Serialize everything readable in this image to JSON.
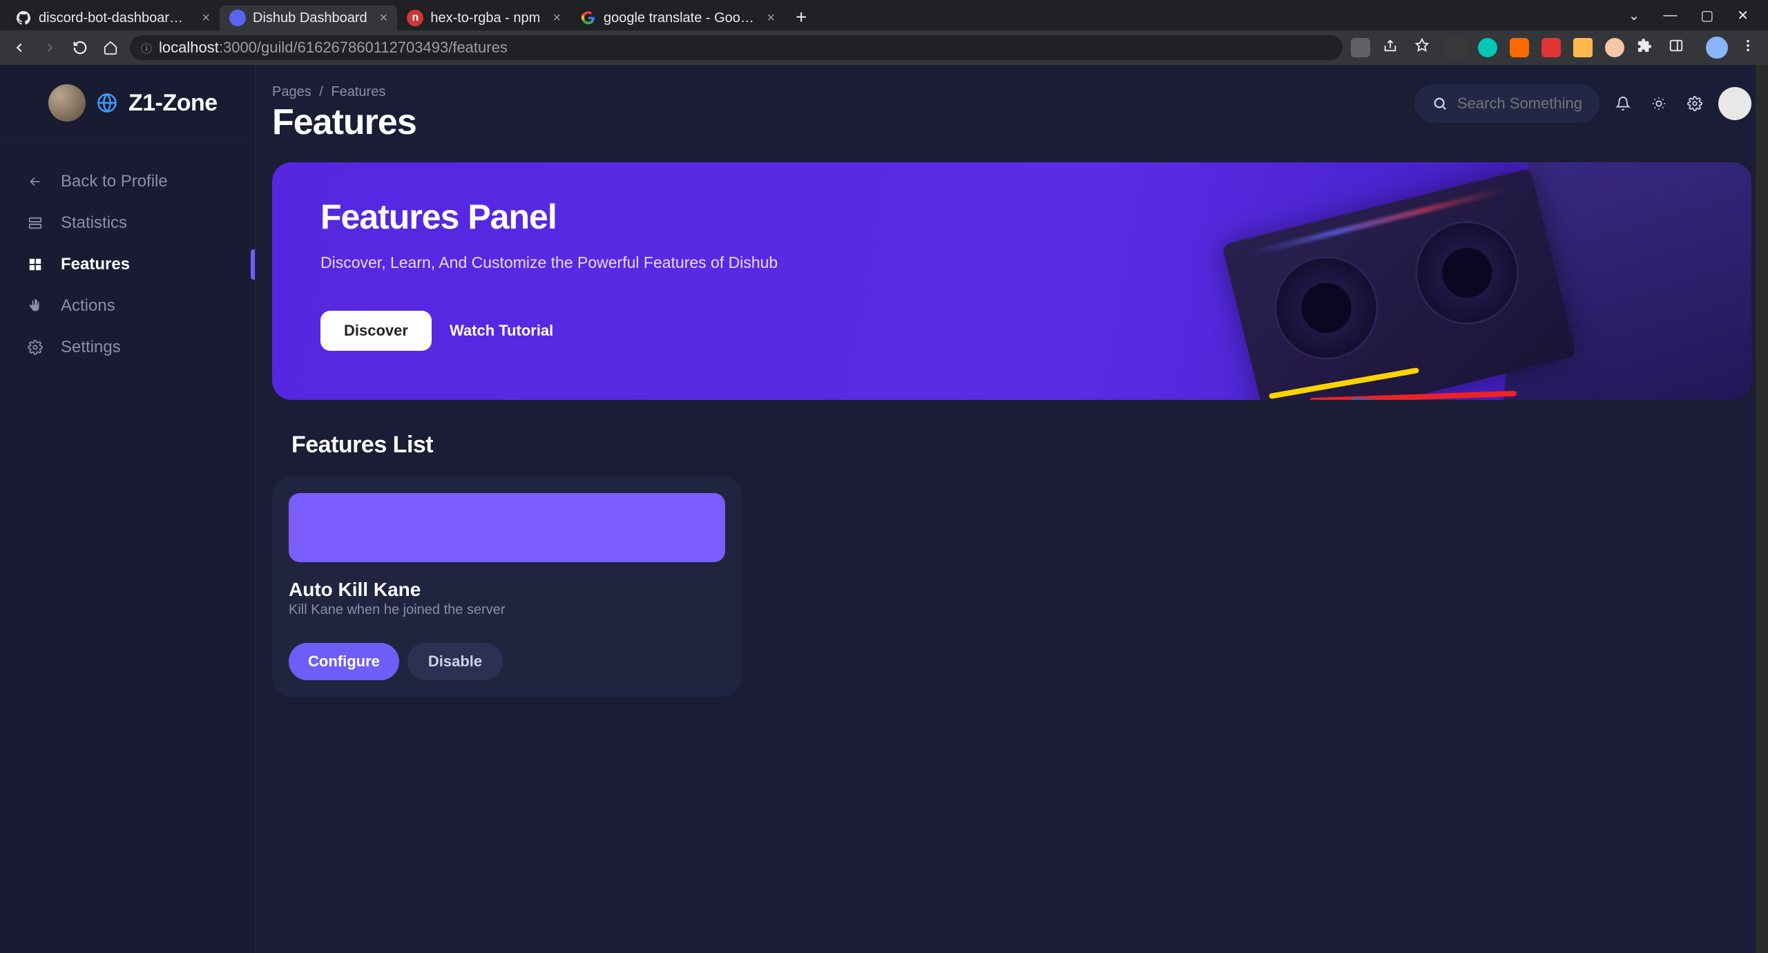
{
  "browser": {
    "tabs": [
      {
        "title": "discord-bot-dashboard-backe",
        "favicon_bg": "#ffffff",
        "favicon_text": ""
      },
      {
        "title": "Dishub Dashboard",
        "favicon_bg": "#5865f2",
        "favicon_text": ""
      },
      {
        "title": "hex-to-rgba - npm",
        "favicon_bg": "#cb3837",
        "favicon_text": "n"
      },
      {
        "title": "google translate - Google Sear",
        "favicon_bg": "#ffffff",
        "favicon_text": "G"
      }
    ],
    "url_host": "localhost",
    "url_port_path": ":3000/guild/616267860112703493/features"
  },
  "sidebar": {
    "guild_name": "Z1-Zone",
    "items": [
      {
        "label": "Back to Profile",
        "icon": "arrow-left"
      },
      {
        "label": "Statistics",
        "icon": "layers"
      },
      {
        "label": "Features",
        "icon": "grid"
      },
      {
        "label": "Actions",
        "icon": "hand"
      },
      {
        "label": "Settings",
        "icon": "gear"
      }
    ],
    "active_index": 2
  },
  "header": {
    "breadcrumb_root": "Pages",
    "breadcrumb_current": "Features",
    "page_title": "Features",
    "search_placeholder": "Search Something..."
  },
  "banner": {
    "title": "Features Panel",
    "subtitle": "Discover, Learn, And Customize the Powerful Features of Dishub",
    "primary_btn": "Discover",
    "secondary_btn": "Watch Tutorial"
  },
  "features_list": {
    "section_title": "Features List",
    "items": [
      {
        "title": "Auto Kill Kane",
        "description": "Kill Kane when he joined the server",
        "configure_label": "Configure",
        "disable_label": "Disable"
      }
    ]
  },
  "colors": {
    "accent": "#6e5df6",
    "bg": "#1a1d35",
    "panel": "#20243f"
  }
}
